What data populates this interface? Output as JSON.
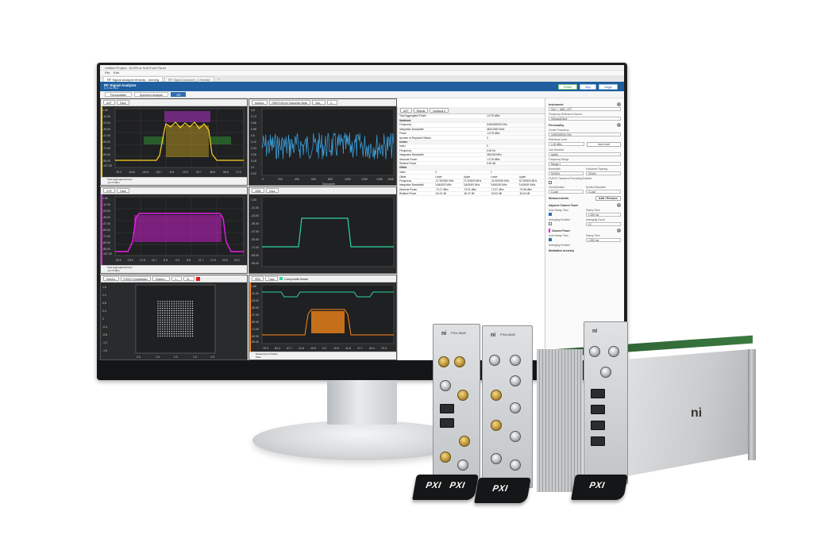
{
  "window": {
    "title": "Untitled Project - NI-RFmx Soft Front Panel",
    "menu": [
      "File",
      "Edit"
    ],
    "tabs": [
      {
        "label": "RF Signal Analyzer.rfmxsfp - running",
        "active": true
      },
      {
        "label": "RF Signal Analyzer_2.rfmxsfp",
        "active": false
      }
    ],
    "add_tab": "+"
  },
  "header": {
    "title": "RF Signal Analyzer",
    "subtitle": "NI PXIe-5840",
    "buttons": {
      "preset": "Preset",
      "stop": "Stop",
      "single": "Single"
    }
  },
  "personalities": {
    "tabs": [
      "Personalities",
      "Spectrum Analyzer",
      "NR"
    ],
    "active": "NR"
  },
  "panels": {
    "acp": {
      "toolbar": [
        "ACP",
        "Trace"
      ],
      "yticks": [
        "1.00",
        "-11.00",
        "-23.00",
        "-35.00",
        "-47.00",
        "-59.00",
        "-71.00",
        "-83.00",
        "-95.00",
        "-107.00",
        "-119.00"
      ],
      "xticks": [
        "-76.2",
        "-64.6",
        "-44.6",
        "-26.7",
        "-8.8",
        "10.9",
        "29.7",
        "48.6",
        "56.6",
        "74.3"
      ],
      "footer_label": "Total Aggregated Power",
      "footer_value": "-10.75 dBm",
      "color": "#ffd21f"
    },
    "modacc": {
      "toolbar": [
        "ModAcc",
        "RMS EVM per Subcarrier Mean",
        "Sub...",
        "C..."
      ],
      "yticks": [
        "0.8",
        "0.74",
        "0.66",
        "0.58",
        "0.5",
        "0.42",
        "0.34",
        "0.26",
        "0.18",
        "0.1",
        "0.02"
      ],
      "xticks": [
        "0",
        "200",
        "400",
        "600",
        "800",
        "1000",
        "1200",
        "1400",
        "1545"
      ],
      "x_axis_label": "Subcarrier",
      "color": "#3ea6e6"
    },
    "chp": {
      "toolbar": [
        "CHP",
        "Trace"
      ],
      "yticks": [
        "1.00",
        "-11.00",
        "-23.00",
        "-35.00",
        "-47.00",
        "-59.00",
        "-71.00",
        "-83.00",
        "-95.00",
        "-107.00",
        "-119.00"
      ],
      "xticks": [
        "-29.2",
        "-23.0",
        "-17.5",
        "-11.7",
        "-5.8",
        "0.0",
        "5.8",
        "11.7",
        "17.5",
        "23.0",
        "29.2"
      ],
      "footer_label": "Total Aggregated Power",
      "footer_value": "-10.75 dBm",
      "color": "#e81ee8"
    },
    "obw": {
      "toolbar": [
        "OBW",
        "Trace"
      ],
      "yticks": [
        "1.00",
        "-11.00",
        "-23.00",
        "-35.00",
        "-47.00",
        "-59.00",
        "-71.00",
        "-83.00",
        "-95.00"
      ],
      "color": "#2fd6a0"
    },
    "constellation": {
      "toolbar": [
        "ModAcc",
        "PUSCH Constellation",
        "Subbloc...",
        "C...",
        "Di..."
      ],
      "yticks": [
        "1.6",
        "1.2",
        "0.8",
        "0.4",
        "0",
        "-0.4",
        "-0.8",
        "-1.2",
        "-1.6"
      ],
      "xticks": [
        "-2.0",
        "-1.0",
        "0.0",
        "1.0",
        "2.0"
      ]
    },
    "sem": {
      "toolbar": [
        "SEM",
        "Trace",
        "Composite Mask"
      ],
      "yticks": [
        "1.00",
        "-11.00",
        "-23.00",
        "-35.00",
        "-47.00",
        "-59.00",
        "-71.00",
        "-83.00",
        "-95.00"
      ],
      "xticks": [
        "-79.3",
        "-63.4",
        "-47.7",
        "-31.8",
        "-15.9",
        "0.0",
        "15.9",
        "31.8",
        "47.7",
        "63.4",
        "79.3"
      ],
      "footer_label": "Measurement Status",
      "footer_value": "Pass",
      "color": "#ff8a1a"
    }
  },
  "results": {
    "toolbar": [
      "ACP",
      "Results",
      "Subblock 0"
    ],
    "rows": [
      {
        "k": "Total Aggregated Power",
        "v": "-10.75 dBm",
        "section": false
      },
      {
        "k": "Subblock",
        "v": "",
        "section": true
      },
      {
        "k": "Frequency",
        "v": "3.500000000 GHz",
        "section": false
      },
      {
        "k": "Integration Bandwidth",
        "v": "48.810000 MHz",
        "section": false
      },
      {
        "k": "Power",
        "v": "-10.75 dBm",
        "section": false
      },
      {
        "k": "Number of Reported Offsets",
        "v": "3",
        "section": false
      },
      {
        "k": "Center",
        "v": "",
        "section": true
      },
      {
        "k": "Index",
        "v": "0",
        "section": false
      },
      {
        "k": "Frequency",
        "v": "0.00 Hz",
        "section": false
      },
      {
        "k": "Integration Bandwidth",
        "v": "48.6150 MHz",
        "section": false
      },
      {
        "k": "Absolute Power",
        "v": "-10.75 dBm",
        "section": false
      },
      {
        "k": "Relative Power",
        "v": "0.00 dB",
        "section": false
      },
      {
        "k": "Offset",
        "v": "",
        "section": true
      }
    ],
    "offset_header": [
      "Index",
      "0",
      "",
      "1",
      ""
    ],
    "offset_cols": [
      "Offset",
      "Lower",
      "Upper",
      "Lower",
      "Upper"
    ],
    "offset_rows": [
      [
        "Frequency",
        "-27.300000 MHz",
        "27.300000 MHz",
        "-32.300000 MHz",
        "32.300000 MHz"
      ],
      [
        "Integration Bandwidth",
        "3.840000 MHz",
        "3.840000 MHz",
        "3.840000 MHz",
        "3.840000 MHz"
      ],
      [
        "Absolute Power",
        "-73.17 dBm",
        "-73.01 dBm",
        "-73.37 dBm",
        "-73.38 dBm"
      ],
      [
        "Relative Power",
        "-62.42 dB",
        "-62.27 dB",
        "-62.62 dB",
        "-62.63 dB"
      ]
    ]
  },
  "settings": {
    "instrument": {
      "title": "Instrument",
      "device": "Slot 7 - 5840_VST",
      "freq_ref_label": "Frequency Reference Source",
      "freq_ref_value": "OnboardClock"
    },
    "personality": {
      "title": "Personality",
      "center_freq_label": "Center Frequency",
      "center_freq_value": "3.500000000 GHz",
      "ref_level_label": "Reference Level",
      "ref_level_value": "1.00 dBm",
      "auto_level": "Auto Level",
      "link_dir_label": "Link Direction",
      "link_dir_value": "Uplink",
      "freq_range_label": "Frequency Range",
      "freq_range_value": "Range 1",
      "bandwidth_label": "Bandwidth",
      "bandwidth_value": "50 MHz",
      "scs_label": "Subcarrier Spacing",
      "scs_value": "30 kHz",
      "pusch_label": "PUSCH Transform Precoding Enabled",
      "slot_alloc_label": "Slot Allocation",
      "slot_alloc_value": "0-Last",
      "sym_alloc_label": "Symbol Allocation",
      "sym_alloc_value": "0-Last"
    },
    "measurements": {
      "title": "Measurements",
      "add_remove": "Add / Remove",
      "acp_title": "Adjacent Channel Power",
      "auto_sweep": "Auto Sweep Time",
      "sweep_time": "Sweep Time",
      "sweep_value": "1.000 ms",
      "avg_enabled": "Averaging Enabled",
      "avg_count": "Averaging Count",
      "avg_count_value": "10",
      "chp_title": "Channel Power",
      "modacc_title": "Modulation Accuracy"
    }
  },
  "hardware": {
    "module_label": "PXIe-5840",
    "pxi": "PXI",
    "ni": "ni"
  }
}
